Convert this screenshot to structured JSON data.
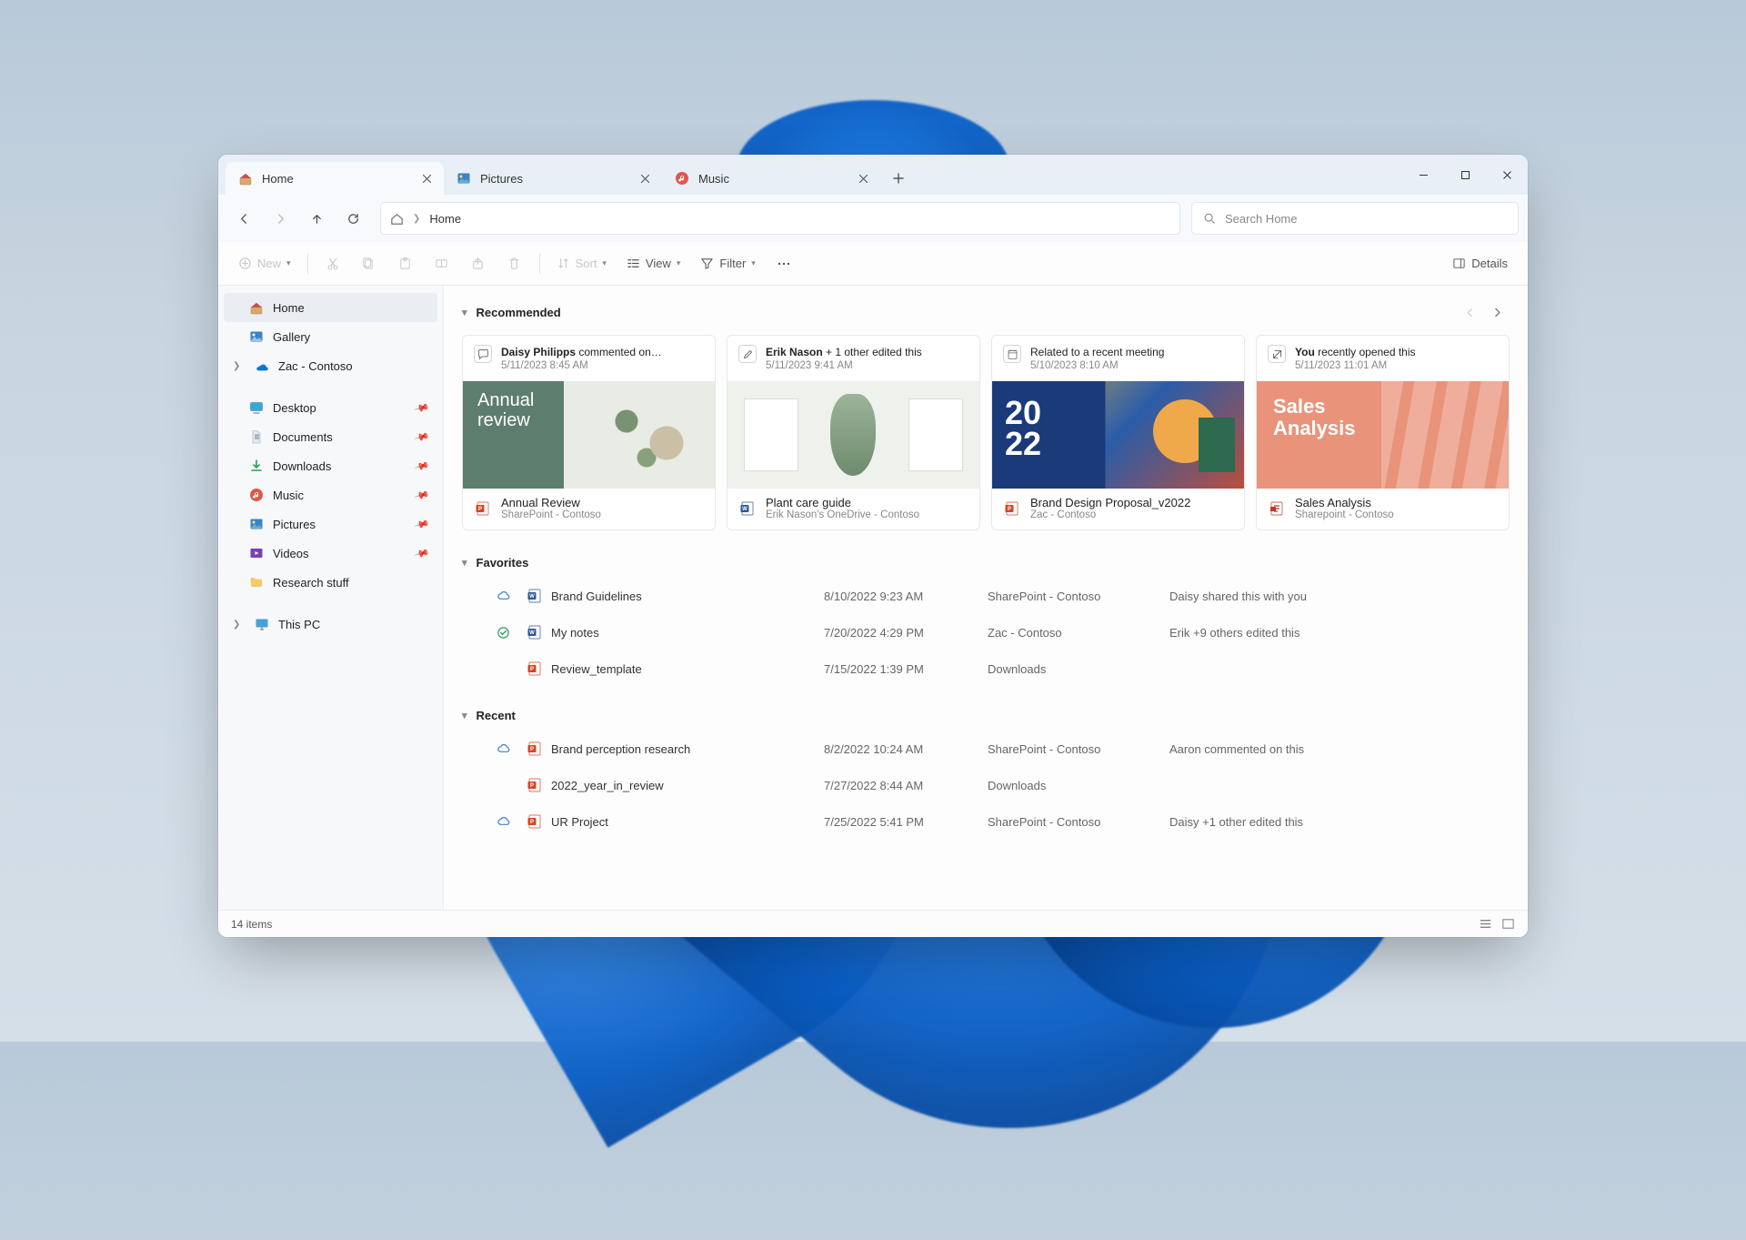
{
  "tabs": [
    {
      "label": "Home",
      "icon": "home",
      "active": true
    },
    {
      "label": "Pictures",
      "icon": "pictures",
      "active": false
    },
    {
      "label": "Music",
      "icon": "music",
      "active": false
    }
  ],
  "address": {
    "crumb": "Home"
  },
  "search": {
    "placeholder": "Search Home"
  },
  "toolbar": {
    "new": "New",
    "sort": "Sort",
    "view": "View",
    "filter": "Filter",
    "details": "Details"
  },
  "sidebar": {
    "top": [
      {
        "label": "Home",
        "icon": "home",
        "selected": true
      },
      {
        "label": "Gallery",
        "icon": "gallery"
      },
      {
        "label": "Zac - Contoso",
        "icon": "onedrive",
        "arrow": true
      }
    ],
    "mid": [
      {
        "label": "Desktop",
        "icon": "desktop",
        "pin": true
      },
      {
        "label": "Documents",
        "icon": "documents",
        "pin": true
      },
      {
        "label": "Downloads",
        "icon": "downloads",
        "pin": true
      },
      {
        "label": "Music",
        "icon": "music",
        "pin": true
      },
      {
        "label": "Pictures",
        "icon": "pictures",
        "pin": true
      },
      {
        "label": "Videos",
        "icon": "videos",
        "pin": true
      },
      {
        "label": "Research stuff",
        "icon": "folder"
      }
    ],
    "bottom": [
      {
        "label": "This PC",
        "icon": "thispc",
        "arrow": true
      }
    ]
  },
  "sections": {
    "recommended": "Recommended",
    "favorites": "Favorites",
    "recent": "Recent"
  },
  "recommended": [
    {
      "who": "Daisy Philipps",
      "action": " commented on…",
      "when": "5/11/2023 8:45 AM",
      "badge": "comment",
      "title": "Annual Review",
      "loc": "SharePoint - Contoso",
      "ft": "ppt"
    },
    {
      "who": "Erik Nason",
      "action": " + 1 other edited this",
      "when": "5/11/2023 9:41 AM",
      "badge": "edit",
      "title": "Plant care guide",
      "loc": "Erik Nason's OneDrive - Contoso",
      "ft": "word"
    },
    {
      "who": "",
      "action": "Related to a recent meeting",
      "when": "5/10/2023 8:10 AM",
      "badge": "calendar",
      "title": "Brand Design Proposal_v2022",
      "loc": "Zac - Contoso",
      "ft": "ppt"
    },
    {
      "who": "You",
      "action": " recently opened this",
      "when": "5/11/2023 11:01 AM",
      "badge": "open",
      "title": "Sales Analysis",
      "loc": "Sharepoint - Contoso",
      "ft": "pdf"
    }
  ],
  "favorites": [
    {
      "status": "cloud",
      "ft": "word",
      "name": "Brand Guidelines",
      "date": "8/10/2022 9:23 AM",
      "loc": "SharePoint - Contoso",
      "activity": "Daisy shared this with you"
    },
    {
      "status": "synced",
      "ft": "word",
      "name": "My notes",
      "date": "7/20/2022 4:29 PM",
      "loc": "Zac - Contoso",
      "activity": "Erik +9 others edited this"
    },
    {
      "status": "",
      "ft": "ppt",
      "name": "Review_template",
      "date": "7/15/2022 1:39 PM",
      "loc": "Downloads",
      "activity": ""
    }
  ],
  "recent": [
    {
      "status": "cloud",
      "ft": "ppt",
      "name": "Brand perception research",
      "date": "8/2/2022 10:24 AM",
      "loc": "SharePoint - Contoso",
      "activity": "Aaron commented on this"
    },
    {
      "status": "",
      "ft": "ppt",
      "name": "2022_year_in_review",
      "date": "7/27/2022 8:44 AM",
      "loc": "Downloads",
      "activity": ""
    },
    {
      "status": "cloud",
      "ft": "ppt",
      "name": "UR Project",
      "date": "7/25/2022 5:41 PM",
      "loc": "SharePoint - Contoso",
      "activity": "Daisy +1 other edited this"
    }
  ],
  "statusbar": {
    "count": "14 items"
  }
}
